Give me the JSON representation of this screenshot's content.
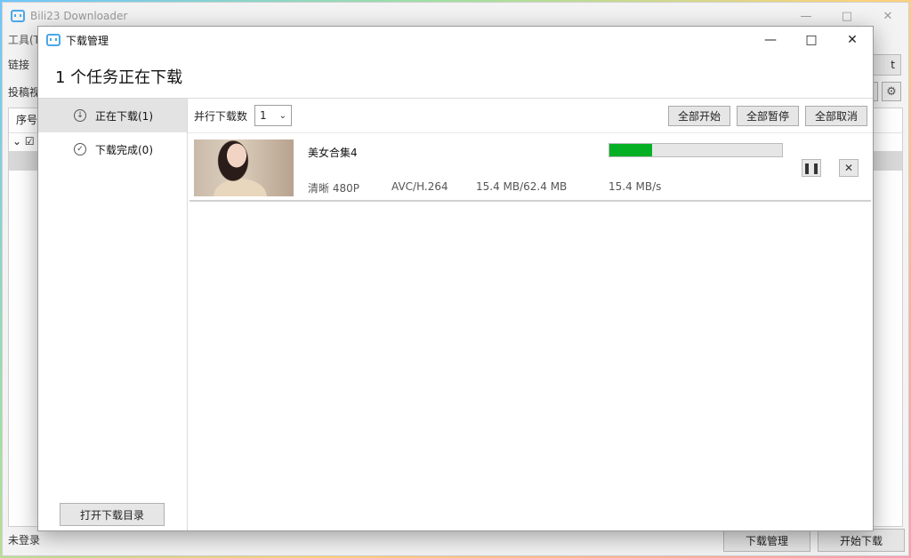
{
  "main": {
    "title": "Bili23 Downloader",
    "menu": "工具(T",
    "link_label": "链接",
    "set_btn": "t",
    "row2_label": "投稿视",
    "table_header": "序号",
    "status": "未登录",
    "btn_download_manager": "下载管理",
    "btn_start_download": "开始下载"
  },
  "dialog": {
    "title": "下载管理",
    "heading": "1 个任务正在下载",
    "sidebar": {
      "items": [
        {
          "label": "正在下载(1)",
          "icon": "download-arrow-icon"
        },
        {
          "label": "下载完成(0)",
          "icon": "check-circle-icon"
        }
      ],
      "open_dir": "打开下载目录"
    },
    "toolbar": {
      "parallel_label": "并行下载数",
      "parallel_value": "1",
      "start_all": "全部开始",
      "pause_all": "全部暂停",
      "cancel_all": "全部取消"
    },
    "tasks": [
      {
        "name": "美女合集4",
        "quality": "清晰 480P",
        "codec": "AVC/H.264",
        "size": "15.4 MB/62.4 MB",
        "speed": "15.4 MB/s",
        "progress": 0.247
      }
    ]
  },
  "colors": {
    "progress": "#06b025",
    "accent_icon": "#4aa8e8"
  }
}
